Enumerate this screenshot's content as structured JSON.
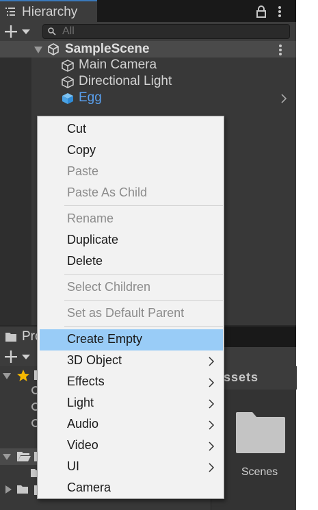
{
  "hierarchy": {
    "tab_label": "Hierarchy",
    "search_placeholder": "All",
    "scene_name": "SampleScene",
    "objects": [
      {
        "label": "Main Camera",
        "icon": "cube-outline-icon"
      },
      {
        "label": "Directional Light",
        "icon": "cube-outline-icon"
      },
      {
        "label": "Egg",
        "icon": "cube-filled-icon",
        "selected": true
      }
    ]
  },
  "project": {
    "tab_label": "Pro",
    "breadcrumb": "ssets",
    "folder_label": "Scenes"
  },
  "context_menu": {
    "items": [
      {
        "label": "Cut",
        "enabled": true
      },
      {
        "label": "Copy",
        "enabled": true
      },
      {
        "label": "Paste",
        "enabled": false
      },
      {
        "label": "Paste As Child",
        "enabled": false
      },
      {
        "label": "Rename",
        "enabled": false
      },
      {
        "label": "Duplicate",
        "enabled": true
      },
      {
        "label": "Delete",
        "enabled": true
      },
      {
        "label": "Select Children",
        "enabled": false
      },
      {
        "label": "Set as Default Parent",
        "enabled": false
      },
      {
        "label": "Create Empty",
        "enabled": true,
        "highlighted": true
      },
      {
        "label": "3D Object",
        "enabled": true,
        "submenu": true
      },
      {
        "label": "Effects",
        "enabled": true,
        "submenu": true
      },
      {
        "label": "Light",
        "enabled": true,
        "submenu": true
      },
      {
        "label": "Audio",
        "enabled": true,
        "submenu": true
      },
      {
        "label": "Video",
        "enabled": true,
        "submenu": true
      },
      {
        "label": "UI",
        "enabled": true,
        "submenu": true
      },
      {
        "label": "Camera",
        "enabled": true
      }
    ]
  },
  "colors": {
    "selection_text": "#5aa0ee",
    "menu_highlight": "#99ccf7",
    "tab_accent": "#3a79bb",
    "favorite_star": "#f5b800"
  }
}
